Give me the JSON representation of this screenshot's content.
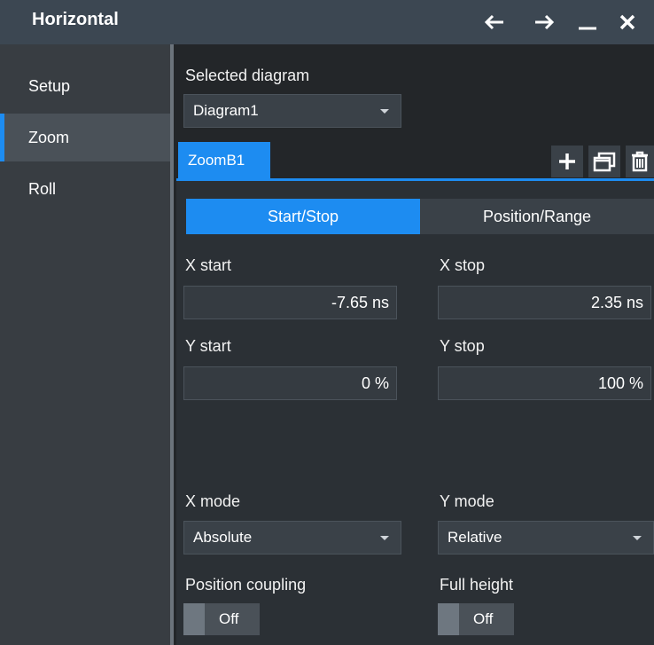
{
  "window": {
    "title": "Horizontal",
    "controls": [
      "arrow-left-icon",
      "arrow-right-icon",
      "minimize-icon",
      "close-icon"
    ]
  },
  "sidebar": {
    "items": [
      {
        "label": "Setup",
        "active": false
      },
      {
        "label": "Zoom",
        "active": true
      },
      {
        "label": "Roll",
        "active": false
      }
    ]
  },
  "main": {
    "selected_diagram_label": "Selected diagram",
    "selected_diagram_value": "Diagram1",
    "tabs": [
      {
        "label": "ZoomB1",
        "active": true
      }
    ],
    "tab_tools": [
      "add-icon",
      "window-copy-icon",
      "trash-icon"
    ],
    "mode_segments": [
      {
        "label": "Start/Stop",
        "active": true
      },
      {
        "label": "Position/Range",
        "active": false
      }
    ],
    "x_start": {
      "label": "X start",
      "value": "-7.65 ns"
    },
    "x_stop": {
      "label": "X stop",
      "value": "2.35 ns"
    },
    "y_start": {
      "label": "Y start",
      "value": "0 %"
    },
    "y_stop": {
      "label": "Y stop",
      "value": "100 %"
    },
    "x_mode": {
      "label": "X mode",
      "value": "Absolute"
    },
    "y_mode": {
      "label": "Y mode",
      "value": "Relative"
    },
    "position_coupling": {
      "label": "Position coupling",
      "state": "Off"
    },
    "full_height": {
      "label": "Full height",
      "state": "Off"
    }
  },
  "colors": {
    "accent": "#1d8cf1",
    "titlebar": "#3c4752",
    "sidebar": "#383d42",
    "panel": "#2b3035"
  }
}
